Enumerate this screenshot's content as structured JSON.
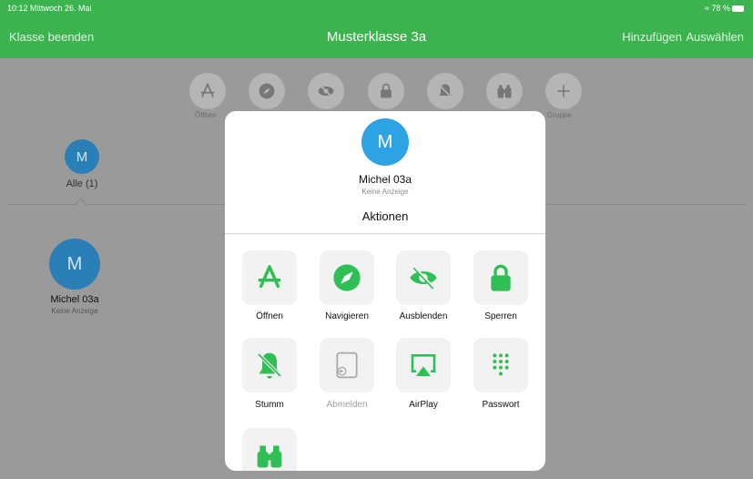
{
  "status_bar": {
    "time_date": "10:12  Mittwoch 26. Mai",
    "battery": "78 %"
  },
  "header": {
    "end_class": "Klasse beenden",
    "title": "Musterklasse 3a",
    "add": "Hinzufügen",
    "select": "Auswählen"
  },
  "toolbar": {
    "open_label": "Öffnen",
    "group_label": "Gruppe"
  },
  "group": {
    "initial": "M",
    "label": "Alle (1)"
  },
  "student": {
    "initial": "M",
    "name": "Michel 03a",
    "status": "Keine Anzeige"
  },
  "modal": {
    "initial": "M",
    "name": "Michel 03a",
    "status": "Keine Anzeige",
    "heading": "Aktionen",
    "actions": [
      {
        "label": "Öffnen",
        "icon": "app-store-icon",
        "enabled": true
      },
      {
        "label": "Navigieren",
        "icon": "compass-icon",
        "enabled": true
      },
      {
        "label": "Ausblenden",
        "icon": "eye-slash-icon",
        "enabled": true
      },
      {
        "label": "Sperren",
        "icon": "lock-icon",
        "enabled": true
      },
      {
        "label": "Stumm",
        "icon": "bell-slash-icon",
        "enabled": true
      },
      {
        "label": "Abmelden",
        "icon": "logout-ipad-icon",
        "enabled": false
      },
      {
        "label": "AirPlay",
        "icon": "airplay-icon",
        "enabled": true
      },
      {
        "label": "Passwort",
        "icon": "keypad-icon",
        "enabled": true
      },
      {
        "label": "",
        "icon": "binoculars-icon",
        "enabled": true
      }
    ]
  },
  "colors": {
    "header_green": "#3cb34f",
    "accent_green": "#34c759",
    "avatar_blue": "#2ea3e3"
  }
}
